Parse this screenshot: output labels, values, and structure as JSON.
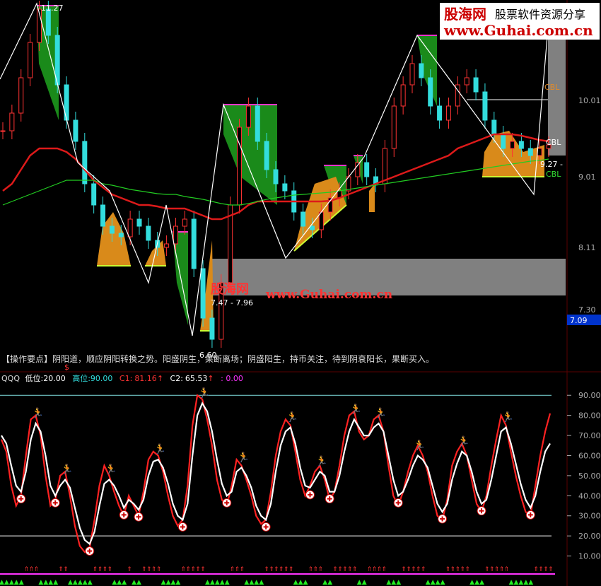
{
  "watermark": {
    "brand": "股海网",
    "slogan": "股票软件资源分享",
    "url": "www.Guhai.com.cn"
  },
  "main_panel": {
    "price_axis_labels": [
      "10.01",
      "9.01",
      "8.11",
      "7.30",
      "7.09"
    ],
    "current_price_label": "7.09",
    "annotations": {
      "high_price": "11.27",
      "low_price": "6.60",
      "zone_range": "7.47 - 7.96",
      "cbl_upper": "CBL",
      "cbl_mid": "CBL",
      "cbl_lower": "CBL",
      "right_value": "9.27 -",
      "dollar_marker": "$"
    },
    "tip_prefix": "【操作要点】",
    "tip_text": "阴阳道，顺应阴阳转换之势。阳盛阴生，果断离场；阴盛阳生，持币关注，待到阴衰阳长，果断买入。"
  },
  "indicator_panel": {
    "name": "QQQ",
    "low_label": "低位:",
    "low_value": "20.00",
    "high_label": "高位:",
    "high_value": "90.00",
    "c1_label": "C1:",
    "c1_value": "81.16",
    "c2_label": "C2:",
    "c2_value": "65.53",
    "extra_value": ": 0.00",
    "axis_labels": [
      "90.00",
      "80.00",
      "70.00",
      "60.00",
      "50.00",
      "40.00",
      "30.00",
      "20.00",
      "10.00"
    ]
  },
  "chart_data": {
    "type": "line",
    "panels": [
      {
        "name": "price",
        "y_axis_ticks": [
          10.01,
          9.01,
          8.11,
          7.3
        ],
        "ylim": [
          6.4,
          11.4
        ],
        "series": [
          {
            "values": [
              9.55,
              9.8,
              10.3,
              10.8,
              11.27,
              10.9,
              10.2,
              9.7,
              9.4,
              8.8,
              8.5,
              8.2,
              8.1,
              8.05,
              8.3,
              8.2,
              8.0,
              7.9,
              7.95,
              8.2,
              8.3,
              7.6,
              6.9,
              6.6,
              7.4,
              8.5,
              9.6,
              9.9,
              9.4,
              9.0,
              8.8,
              8.7,
              8.4,
              8.2,
              8.15,
              8.4,
              8.6,
              8.7,
              8.9,
              9.1,
              8.9,
              8.8,
              9.3,
              9.9,
              10.2,
              10.5,
              10.3,
              9.9,
              9.7,
              9.9,
              10.2,
              10.3,
              10.1,
              9.7,
              9.5,
              9.3,
              9.4,
              9.3,
              9.2,
              9.3,
              9.35
            ]
          },
          {
            "values": [
              8.7,
              8.8,
              9.0,
              9.2,
              9.3,
              9.3,
              9.3,
              9.25,
              9.15,
              9.0,
              8.85,
              8.75,
              8.65,
              8.6,
              8.55,
              8.5,
              8.5,
              8.48,
              8.45,
              8.45,
              8.45,
              8.4,
              8.35,
              8.3,
              8.3,
              8.35,
              8.4,
              8.5,
              8.55,
              8.55,
              8.55,
              8.55,
              8.55,
              8.55,
              8.55,
              8.55,
              8.56,
              8.6,
              8.65,
              8.7,
              8.75,
              8.8,
              8.85,
              8.9,
              8.95,
              9.0,
              9.05,
              9.1,
              9.15,
              9.2,
              9.3,
              9.35,
              9.4,
              9.45,
              9.5,
              9.5,
              9.5,
              9.48,
              9.45,
              9.42,
              9.4
            ]
          },
          {
            "values": [
              8.5,
              8.55,
              8.6,
              8.65,
              8.7,
              8.75,
              8.8,
              8.85,
              8.85,
              8.85,
              8.85,
              8.8,
              8.78,
              8.75,
              8.72,
              8.7,
              8.68,
              8.66,
              8.65,
              8.65,
              8.62,
              8.6,
              8.58,
              8.55,
              8.52,
              8.5,
              8.5,
              8.52,
              8.55,
              8.58,
              8.6,
              8.62,
              8.64,
              8.65,
              8.66,
              8.67,
              8.68,
              8.7,
              8.72,
              8.74,
              8.76,
              8.78,
              8.8,
              8.82,
              8.84,
              8.86,
              8.88,
              8.9,
              8.92,
              8.94,
              8.96,
              8.98,
              9.0,
              9.02,
              9.04,
              9.06,
              9.08,
              9.1,
              9.12,
              9.13,
              9.15
            ]
          }
        ]
      },
      {
        "name": "QQQ",
        "ylim": [
          0,
          95
        ],
        "y_axis_ticks": [
          90,
          80,
          70,
          60,
          50,
          40,
          30,
          20,
          10
        ],
        "reference_lines": [
          90,
          20
        ],
        "series": [
          {
            "name": "C1",
            "values": [
              68,
              62,
              45,
              35,
              40,
              60,
              78,
              80,
              70,
              50,
              35,
              38,
              50,
              52,
              40,
              25,
              15,
              12,
              14,
              28,
              45,
              55,
              50,
              42,
              35,
              30,
              40,
              35,
              30,
              42,
              58,
              62,
              60,
              52,
              40,
              30,
              25,
              28,
              45,
              75,
              90,
              88,
              78,
              65,
              48,
              38,
              35,
              45,
              58,
              55,
              48,
              40,
              30,
              26,
              28,
              42,
              60,
              72,
              78,
              75,
              62,
              48,
              40,
              45,
              52,
              55,
              48,
              38,
              42,
              55,
              70,
              80,
              82,
              72,
              68,
              70,
              78,
              80,
              72,
              55,
              40,
              35,
              42,
              52,
              60,
              65,
              60,
              52,
              40,
              30,
              28,
              38,
              55,
              62,
              66,
              60,
              48,
              36,
              32,
              40,
              55,
              68,
              80,
              75,
              62,
              50,
              40,
              32,
              30,
              45,
              60,
              72,
              81
            ]
          },
          {
            "name": "C2",
            "values": [
              70,
              66,
              55,
              45,
              42,
              52,
              68,
              76,
              72,
              60,
              45,
              40,
              45,
              48,
              44,
              34,
              24,
              18,
              16,
              22,
              35,
              46,
              48,
              45,
              40,
              34,
              38,
              36,
              33,
              38,
              50,
              57,
              58,
              54,
              46,
              36,
              30,
              28,
              36,
              60,
              80,
              86,
              82,
              72,
              58,
              46,
              40,
              42,
              52,
              54,
              50,
              44,
              35,
              30,
              28,
              36,
              52,
              65,
              72,
              74,
              66,
              54,
              45,
              44,
              48,
              52,
              50,
              42,
              42,
              50,
              62,
              72,
              78,
              74,
              70,
              70,
              74,
              76,
              72,
              60,
              48,
              40,
              42,
              48,
              55,
              60,
              58,
              54,
              45,
              36,
              32,
              36,
              48,
              56,
              62,
              60,
              52,
              42,
              36,
              38,
              48,
              60,
              72,
              74,
              66,
              56,
              46,
              38,
              34,
              40,
              52,
              62,
              66
            ]
          }
        ]
      }
    ]
  }
}
